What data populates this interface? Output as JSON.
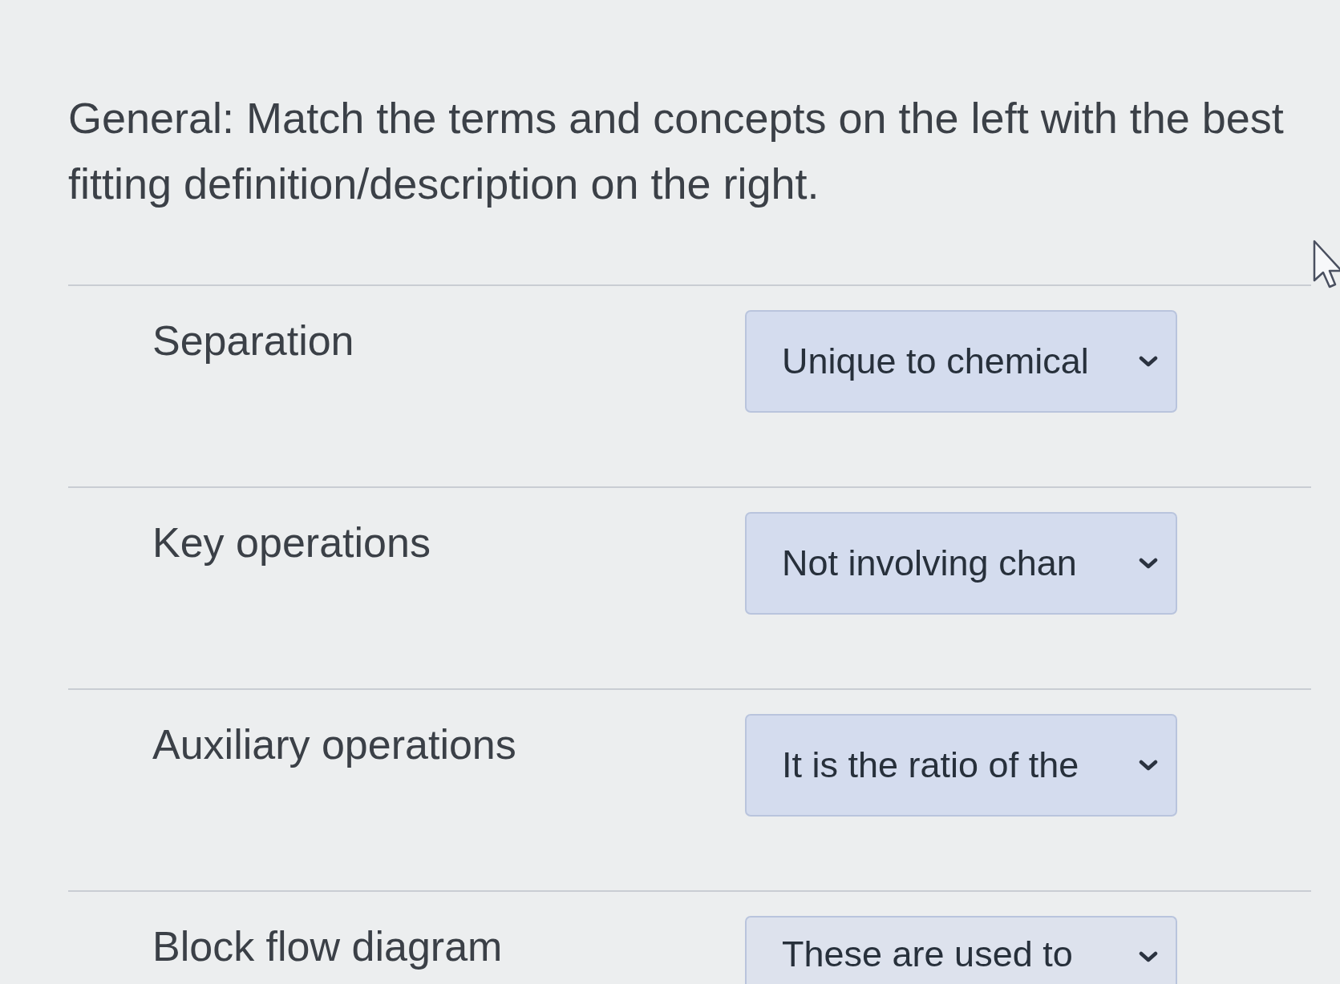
{
  "question": {
    "prompt": "General: Match the terms and concepts on the left with the best fitting definition/description on the right."
  },
  "matches": [
    {
      "term": "Separation",
      "answer": "Unique to chemical"
    },
    {
      "term": "Key operations",
      "answer": "Not involving chan"
    },
    {
      "term": "Auxiliary operations",
      "answer": "It is the ratio of the"
    },
    {
      "term": "Block flow diagram",
      "answer": "These are used to"
    }
  ]
}
